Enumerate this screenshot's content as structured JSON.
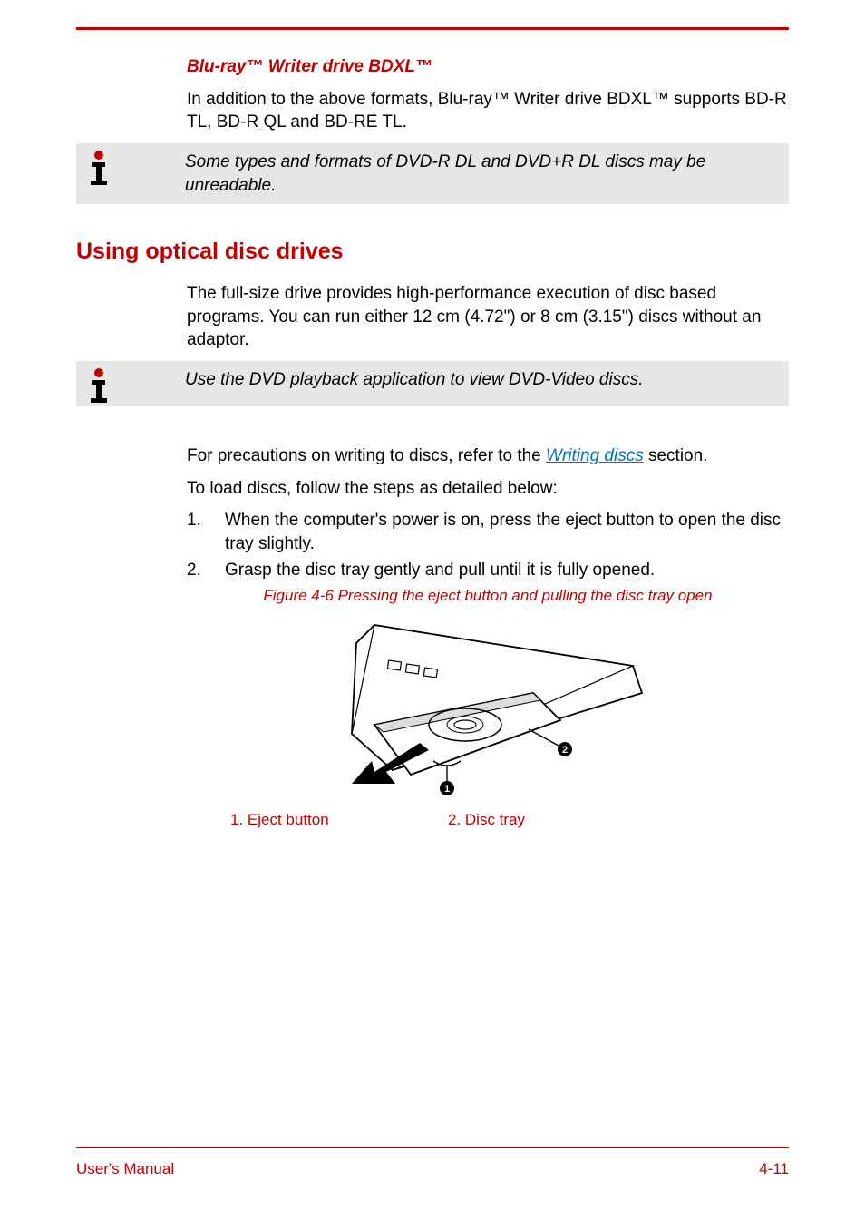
{
  "sub1": {
    "title": "Blu-ray™ Writer drive BDXL™",
    "body": "In addition to the above formats, Blu-ray™ Writer drive BDXL™ supports BD-R TL, BD-R QL and BD-RE TL."
  },
  "note1": "Some types and formats of DVD-R DL and DVD+R DL discs may be unreadable.",
  "section": {
    "title": "Using optical disc drives",
    "intro": "The full-size drive provides high-performance execution of disc based programs. You can run either 12 cm (4.72\") or 8 cm (3.15\") discs without an adaptor."
  },
  "note2": "Use the DVD playback application to view DVD-Video discs.",
  "precautions_pre": "For precautions on writing to discs, refer to the ",
  "precautions_link": "Writing discs",
  "precautions_post": " section.",
  "load_intro": "To load discs, follow the steps as detailed below:",
  "steps": {
    "n1": "1.",
    "t1": "When the computer's power is on, press the eject button to open the disc tray slightly.",
    "n2": "2.",
    "t2": "Grasp the disc tray gently and pull until it is fully opened."
  },
  "figure_caption": "Figure 4-6 Pressing the eject button and pulling the disc tray open",
  "legend": {
    "l1": "1. Eject button",
    "l2": "2. Disc tray"
  },
  "footer": {
    "left": "User's Manual",
    "right": "4-11"
  }
}
